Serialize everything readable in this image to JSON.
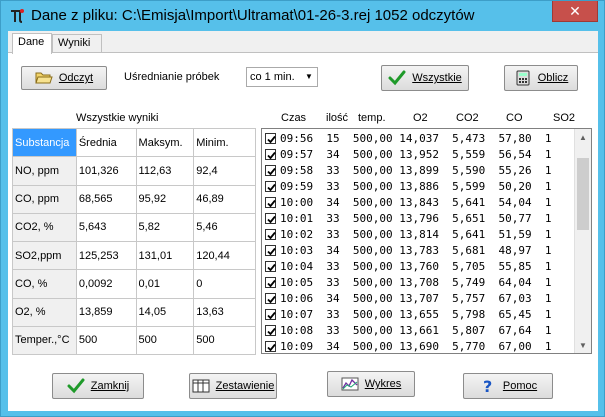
{
  "window": {
    "title": "Dane z pliku: C:\\Emisja\\Import\\Ultramat\\01-26-3.rej  1052 odczytów",
    "close_glyph": "✕"
  },
  "tabs": [
    {
      "label": "Dane"
    },
    {
      "label": "Wyniki"
    }
  ],
  "toolbar": {
    "open_label": "Odczyt",
    "averaging_label": "Uśrednianie próbek",
    "averaging_value": "co 1 min.",
    "all_label": "Wszystkie",
    "calc_label": "Oblicz"
  },
  "summary": {
    "caption": "Wszystkie wyniki",
    "headers": [
      "Substancja",
      "Średnia",
      "Maksym.",
      "Minim."
    ],
    "rows": [
      [
        "NO, ppm",
        "101,326",
        "112,63",
        "92,4"
      ],
      [
        "CO, ppm",
        "68,565",
        "95,92",
        "46,89"
      ],
      [
        "CO2, %",
        "5,643",
        "5,82",
        "5,46"
      ],
      [
        "SO2,ppm",
        "125,253",
        "131,01",
        "120,44"
      ],
      [
        "CO, %",
        "0,0092",
        "0,01",
        "0"
      ],
      [
        "O2, %",
        "13,859",
        "14,05",
        "13,63"
      ],
      [
        "Temper.,°C",
        "500",
        "500",
        "500"
      ]
    ]
  },
  "readings": {
    "columns": [
      "Czas",
      "ilość",
      "temp.",
      "O2",
      "CO2",
      "CO",
      "SO2"
    ],
    "rows": [
      "09:56  15  500,00 14,037  5,473  57,80  1",
      "09:57  34  500,00 13,952  5,559  56,54  1",
      "09:58  33  500,00 13,899  5,590  55,26  1",
      "09:59  33  500,00 13,886  5,599  50,20  1",
      "10:00  34  500,00 13,843  5,641  54,04  1",
      "10:01  33  500,00 13,796  5,651  50,77  1",
      "10:02  33  500,00 13,814  5,641  51,59  1",
      "10:03  34  500,00 13,783  5,681  48,97  1",
      "10:04  33  500,00 13,760  5,705  55,85  1",
      "10:05  33  500,00 13,708  5,749  64,04  1",
      "10:06  34  500,00 13,707  5,757  67,03  1",
      "10:07  33  500,00 13,655  5,798  65,45  1",
      "10:08  33  500,00 13,661  5,807  67,64  1",
      "10:09  34  500,00 13,690  5,770  67,00  1"
    ],
    "scroll_position": 0.1
  },
  "footer": {
    "close_label": "Zamknij",
    "summary_label": "Zestawienie",
    "chart_label": "Wykres",
    "help_label": "Pomoc"
  }
}
